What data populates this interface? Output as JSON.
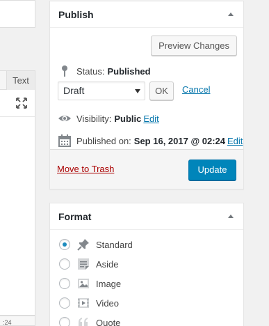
{
  "editor": {
    "text_tab": "Text",
    "bottom_text": ":24"
  },
  "publish": {
    "title": "Publish",
    "preview_button": "Preview Changes",
    "status_label": "Status:",
    "status_value": "Published",
    "status_select_value": "Draft",
    "ok_button": "OK",
    "cancel_link": "Cancel",
    "visibility_label": "Visibility:",
    "visibility_value": "Public",
    "visibility_edit": "Edit",
    "published_label": "Published on:",
    "published_value": "Sep 16, 2017 @ 02:24",
    "published_edit": "Edit",
    "trash_link": "Move to Trash",
    "update_button": "Update"
  },
  "format": {
    "title": "Format",
    "selected": "Standard",
    "options": [
      {
        "label": "Standard",
        "icon": "pushpin-icon"
      },
      {
        "label": "Aside",
        "icon": "aside-icon"
      },
      {
        "label": "Image",
        "icon": "image-icon"
      },
      {
        "label": "Video",
        "icon": "video-icon"
      },
      {
        "label": "Quote",
        "icon": "quote-icon"
      }
    ]
  },
  "colors": {
    "primary": "#0085ba",
    "link": "#0073aa",
    "trash": "#aa0000",
    "icon": "#82878c"
  }
}
